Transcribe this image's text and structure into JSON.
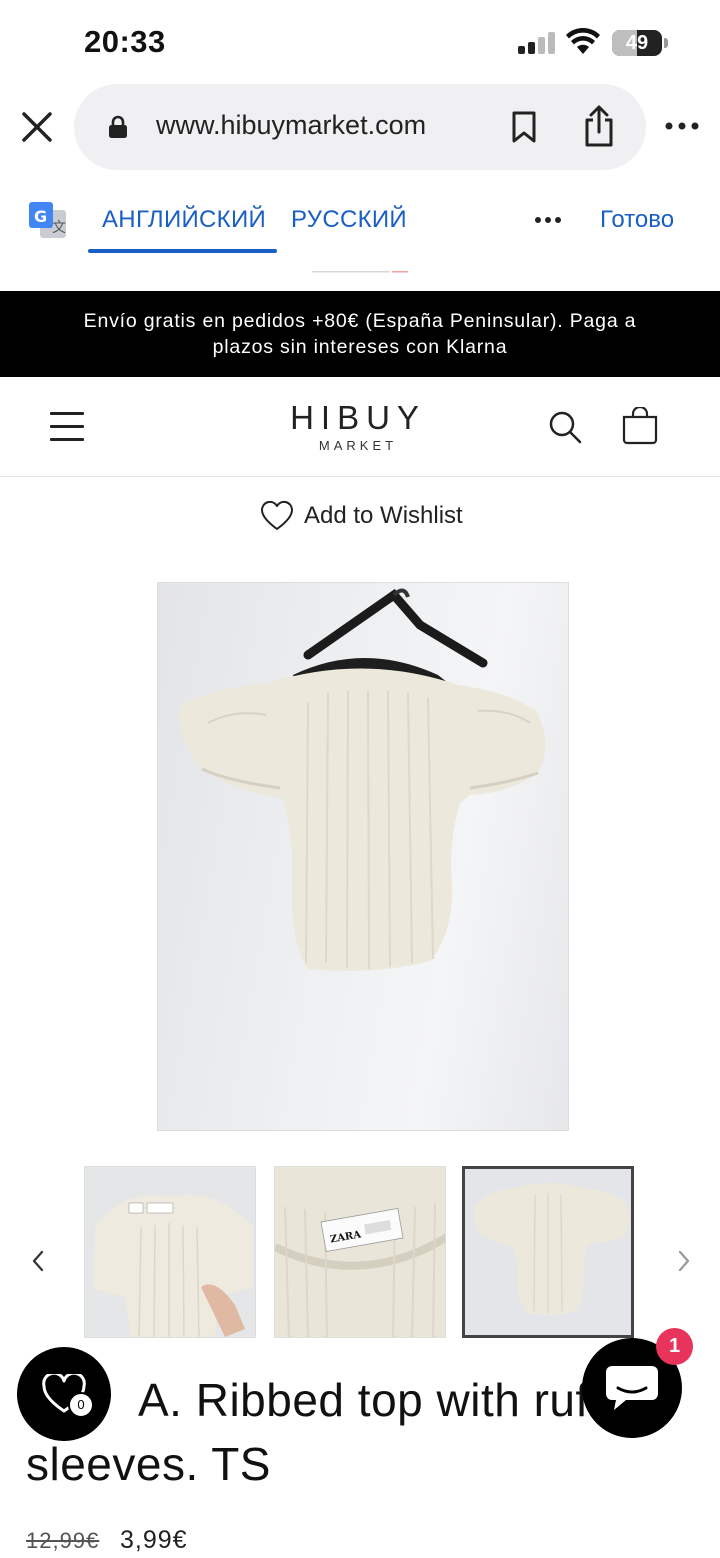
{
  "status_bar": {
    "time": "20:33",
    "battery": "49",
    "battery_level": 0.49,
    "icons": [
      "cellular-signal-icon",
      "wifi-icon",
      "battery-icon"
    ]
  },
  "browser": {
    "url": "www.hibuymarket.com",
    "icons": [
      "close-icon",
      "lock-icon",
      "bookmark-icon",
      "share-icon",
      "more-icon"
    ]
  },
  "translate": {
    "tab_source": "АНГЛИЙСКИЙ",
    "tab_target": "РУССКИЙ",
    "done_label": "Готово",
    "icons": [
      "google-translate-icon",
      "more-horizontal-icon"
    ]
  },
  "announcement": {
    "line1": "Envío gratis en pedidos +80€ (España Peninsular). Paga a",
    "line2": "plazos sin intereses con Klarna"
  },
  "header": {
    "logo_main": "HIBUY",
    "logo_sub": "MARKET",
    "icons": [
      "menu-icon",
      "search-icon",
      "cart-icon"
    ]
  },
  "wishlist": {
    "label": "Add to Wishlist",
    "icon": "heart-icon"
  },
  "gallery": {
    "selected_index": 2,
    "thumbnail_count": 3,
    "icons": [
      "chevron-left-icon",
      "chevron-right-icon"
    ]
  },
  "product": {
    "title": "ZARA. Ribbed top with ruffle sleeves. TS",
    "title_visible": "A. Ribbed top with ruf",
    "title_line2": "sleeves. TS",
    "price_old": "12,99€",
    "price_new": "3,99€"
  },
  "floating": {
    "wishlist_count": "0",
    "chat_badge": "1",
    "icons": [
      "heart-icon",
      "chat-icon"
    ]
  },
  "colors": {
    "link_blue": "#1a5fc4",
    "announcement_bg": "#000000",
    "badge_red": "#e8335a",
    "garment_cream": "#efece2"
  }
}
